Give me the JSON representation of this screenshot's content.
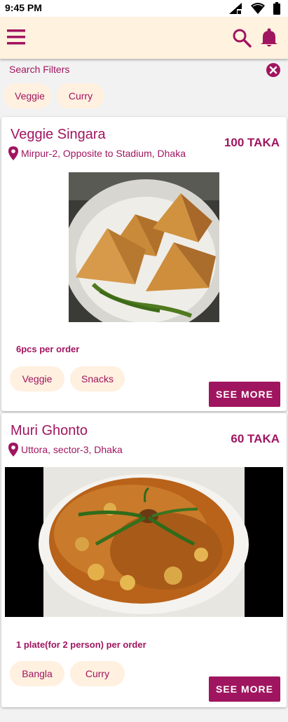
{
  "status_bar": {
    "time": "9:45 PM"
  },
  "app_bar": {
    "menu_icon": "hamburger-menu-icon",
    "search_icon": "search-icon",
    "notification_icon": "bell-icon"
  },
  "filters": {
    "label": "Search Filters",
    "clear_icon": "close-circle-icon",
    "chips": [
      "Veggie",
      "Curry"
    ]
  },
  "items": [
    {
      "title": "Veggie Singara",
      "price": "100 TAKA",
      "location": "Mirpur-2, Opposite to Stadium, Dhaka",
      "note": "6pcs per order",
      "tags": [
        "Veggie",
        "Snacks"
      ],
      "see_more": "SEE MORE"
    },
    {
      "title": "Muri Ghonto",
      "price": "60 TAKA",
      "location": "Uttora, sector-3, Dhaka",
      "note": "1 plate(for 2 person) per order",
      "tags": [
        "Bangla",
        "Curry"
      ],
      "see_more": "SEE MORE"
    }
  ],
  "colors": {
    "accent": "#a0155f",
    "chip_bg": "#fff0df",
    "appbar_bg": "#fff2df"
  }
}
